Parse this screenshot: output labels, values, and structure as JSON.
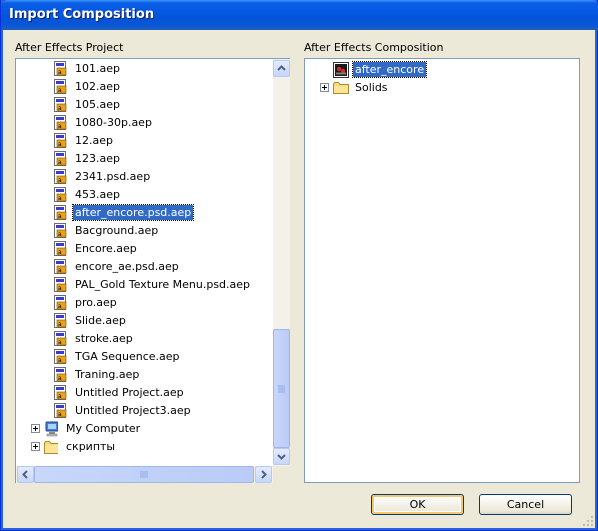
{
  "window": {
    "title": "Import Composition"
  },
  "left_panel": {
    "label": "After Effects Project",
    "items": [
      {
        "label": "101.aep",
        "icon": "aep-file-icon",
        "selected": false
      },
      {
        "label": "102.aep",
        "icon": "aep-file-icon",
        "selected": false
      },
      {
        "label": "105.aep",
        "icon": "aep-file-icon",
        "selected": false
      },
      {
        "label": "1080-30p.aep",
        "icon": "aep-file-icon",
        "selected": false
      },
      {
        "label": "12.aep",
        "icon": "aep-file-icon",
        "selected": false
      },
      {
        "label": "123.aep",
        "icon": "aep-file-icon",
        "selected": false
      },
      {
        "label": "2341.psd.aep",
        "icon": "aep-file-icon",
        "selected": false
      },
      {
        "label": "453.aep",
        "icon": "aep-file-icon",
        "selected": false
      },
      {
        "label": "after_encore.psd.aep",
        "icon": "aep-file-icon",
        "selected": true
      },
      {
        "label": "Bacground.aep",
        "icon": "aep-file-icon",
        "selected": false
      },
      {
        "label": "Encore.aep",
        "icon": "aep-file-icon",
        "selected": false
      },
      {
        "label": "encore_ae.psd.aep",
        "icon": "aep-file-icon",
        "selected": false
      },
      {
        "label": "PAL_Gold Texture Menu.psd.aep",
        "icon": "aep-file-icon",
        "selected": false
      },
      {
        "label": "pro.aep",
        "icon": "aep-file-icon",
        "selected": false
      },
      {
        "label": "Slide.aep",
        "icon": "aep-file-icon",
        "selected": false
      },
      {
        "label": "stroke.aep",
        "icon": "aep-file-icon",
        "selected": false
      },
      {
        "label": "TGA Sequence.aep",
        "icon": "aep-file-icon",
        "selected": false
      },
      {
        "label": "Traning.aep",
        "icon": "aep-file-icon",
        "selected": false
      },
      {
        "label": "Untitled Project.aep",
        "icon": "aep-file-icon",
        "selected": false
      },
      {
        "label": "Untitled Project3.aep",
        "icon": "aep-file-icon",
        "selected": false
      }
    ],
    "roots": [
      {
        "label": "My Computer",
        "icon": "my-computer-icon"
      },
      {
        "label": "скрипты",
        "icon": "folder-icon"
      }
    ]
  },
  "right_panel": {
    "label": "After Effects Composition",
    "items": [
      {
        "label": "after_encore",
        "icon": "composition-icon",
        "selected": true
      },
      {
        "label": "Solids",
        "icon": "folder-icon",
        "selected": false
      }
    ]
  },
  "buttons": {
    "ok": "OK",
    "cancel": "Cancel"
  },
  "colors": {
    "title_bar": "#0054e3",
    "selection": "#316ac5",
    "dialog_bg": "#ece9d8",
    "panel_border": "#7f9db9"
  }
}
